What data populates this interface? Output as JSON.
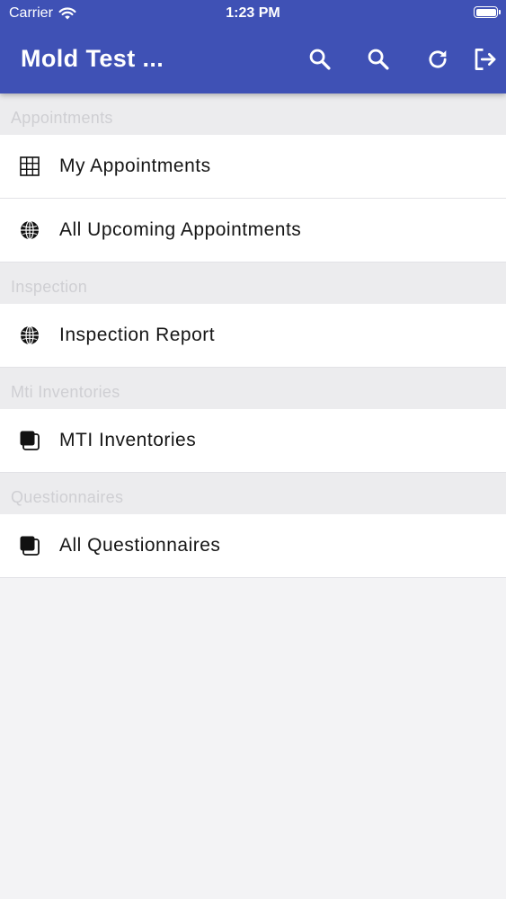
{
  "status_bar": {
    "carrier": "Carrier",
    "time": "1:23 PM"
  },
  "header": {
    "title": "Mold Test ...",
    "background": "#3f51b5",
    "actions": [
      {
        "icon": "search-icon"
      },
      {
        "icon": "search-icon"
      },
      {
        "icon": "refresh-icon"
      },
      {
        "icon": "logout-icon"
      }
    ]
  },
  "sections": [
    {
      "title": "Appointments",
      "items": [
        {
          "label": "My Appointments",
          "icon": "grid-icon"
        },
        {
          "label": "All Upcoming Appointments",
          "icon": "globe-icon"
        }
      ]
    },
    {
      "title": "Inspection",
      "items": [
        {
          "label": "Inspection Report",
          "icon": "globe-icon"
        }
      ]
    },
    {
      "title": "Mti Inventories",
      "items": [
        {
          "label": "MTI Inventories",
          "icon": "stack-icon"
        }
      ]
    },
    {
      "title": "Questionnaires",
      "items": [
        {
          "label": "All Questionnaires",
          "icon": "stack-icon"
        }
      ]
    }
  ]
}
